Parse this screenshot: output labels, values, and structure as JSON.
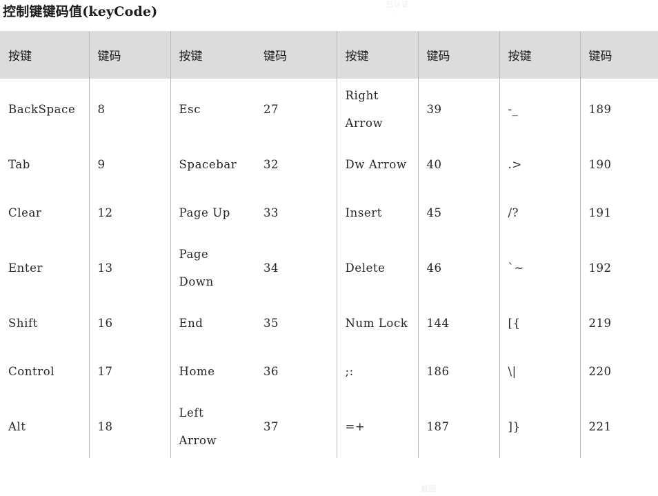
{
  "page": {
    "title": "控制键键码值(keyCode)",
    "watermark_top": "已认证",
    "watermark_top_sub": "·",
    "watermark_bottom": "截图"
  },
  "colors": {
    "header_background": "#dcdcdc",
    "page_background": "#ffffff",
    "divider": "#b9b9b9",
    "text": "#262626",
    "title_text": "#1a1a1a"
  },
  "table": {
    "headers": [
      "按键",
      "键码",
      "按键",
      "键码",
      "按键",
      "键码",
      "按键",
      "键码"
    ],
    "rows": [
      {
        "height": "tall",
        "cells": [
          {
            "lines": [
              "BackSpace"
            ]
          },
          {
            "lines": [
              "8"
            ]
          },
          {
            "lines": [
              "Esc"
            ]
          },
          {
            "lines": [
              "27"
            ]
          },
          {
            "lines": [
              "Right",
              "Arrow"
            ]
          },
          {
            "lines": [
              "39"
            ]
          },
          {
            "lines": [
              "-_"
            ]
          },
          {
            "lines": [
              "189"
            ]
          }
        ]
      },
      {
        "height": "normal",
        "cells": [
          {
            "lines": [
              "Tab"
            ]
          },
          {
            "lines": [
              "9"
            ]
          },
          {
            "lines": [
              "Spacebar"
            ]
          },
          {
            "lines": [
              "32"
            ]
          },
          {
            "lines": [
              "Dw Arrow"
            ]
          },
          {
            "lines": [
              "40"
            ]
          },
          {
            "lines": [
              ".>"
            ]
          },
          {
            "lines": [
              "190"
            ]
          }
        ]
      },
      {
        "height": "normal",
        "cells": [
          {
            "lines": [
              "Clear"
            ]
          },
          {
            "lines": [
              "12"
            ]
          },
          {
            "lines": [
              "Page Up"
            ]
          },
          {
            "lines": [
              "33"
            ]
          },
          {
            "lines": [
              "Insert"
            ]
          },
          {
            "lines": [
              "45"
            ]
          },
          {
            "lines": [
              "/?"
            ]
          },
          {
            "lines": [
              "191"
            ]
          }
        ]
      },
      {
        "height": "tall",
        "cells": [
          {
            "lines": [
              "Enter"
            ]
          },
          {
            "lines": [
              "13"
            ]
          },
          {
            "lines": [
              "Page",
              "Down"
            ]
          },
          {
            "lines": [
              "34"
            ]
          },
          {
            "lines": [
              "Delete"
            ]
          },
          {
            "lines": [
              "46"
            ]
          },
          {
            "lines": [
              "`~"
            ]
          },
          {
            "lines": [
              "192"
            ]
          }
        ]
      },
      {
        "height": "normal",
        "cells": [
          {
            "lines": [
              "Shift"
            ]
          },
          {
            "lines": [
              "16"
            ]
          },
          {
            "lines": [
              "End"
            ]
          },
          {
            "lines": [
              "35"
            ]
          },
          {
            "lines": [
              "Num Lock"
            ]
          },
          {
            "lines": [
              "144"
            ]
          },
          {
            "lines": [
              "[{"
            ]
          },
          {
            "lines": [
              "219"
            ]
          }
        ]
      },
      {
        "height": "normal",
        "cells": [
          {
            "lines": [
              "Control"
            ]
          },
          {
            "lines": [
              "17"
            ]
          },
          {
            "lines": [
              "Home"
            ]
          },
          {
            "lines": [
              "36"
            ]
          },
          {
            "lines": [
              ";:"
            ]
          },
          {
            "lines": [
              "186"
            ]
          },
          {
            "lines": [
              "\\|"
            ]
          },
          {
            "lines": [
              "220"
            ]
          }
        ]
      },
      {
        "height": "tall",
        "cells": [
          {
            "lines": [
              "Alt"
            ]
          },
          {
            "lines": [
              "18"
            ]
          },
          {
            "lines": [
              "Left",
              "Arrow"
            ]
          },
          {
            "lines": [
              "37"
            ]
          },
          {
            "lines": [
              "=+"
            ]
          },
          {
            "lines": [
              "187"
            ]
          },
          {
            "lines": [
              "]}"
            ]
          },
          {
            "lines": [
              "221"
            ]
          }
        ]
      }
    ]
  }
}
